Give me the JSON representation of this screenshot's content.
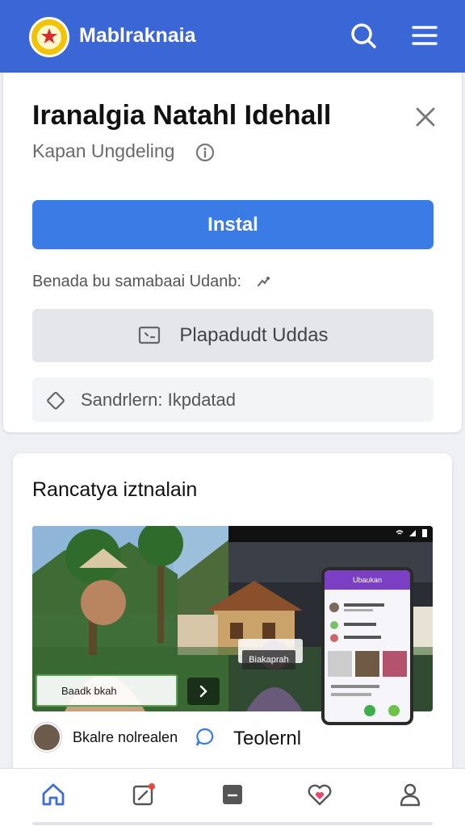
{
  "header": {
    "brand": "Mablraknaia",
    "logo_color": "#f2c300",
    "bar_color": "#3b66d6",
    "icons": [
      "search-icon",
      "menu-icon"
    ]
  },
  "panel": {
    "title": "Iranalgia Natahl Idehall",
    "subtitle": "Kapan Ungdeling",
    "install_label": "Instal",
    "install_color": "#3a7be5",
    "note": "Benada bu samabaai Udanb:",
    "secondary_label": "Plapadudt Uddas",
    "tag_label": "Sandrlern: Ikpdatad"
  },
  "feature": {
    "section_title": "Rancatya iztnalain",
    "overlay_caption": "Baadk bkah",
    "mid_caption": "Biakaprah",
    "phone_header": "Ubaukan",
    "author_name": "Bkalre nolrealen",
    "translate_label": "Teolernl"
  },
  "nav": {
    "items": [
      "home-icon",
      "compose-icon",
      "inbox-icon",
      "heart-icon",
      "profile-icon"
    ],
    "active_color": "#3a6fd8"
  }
}
